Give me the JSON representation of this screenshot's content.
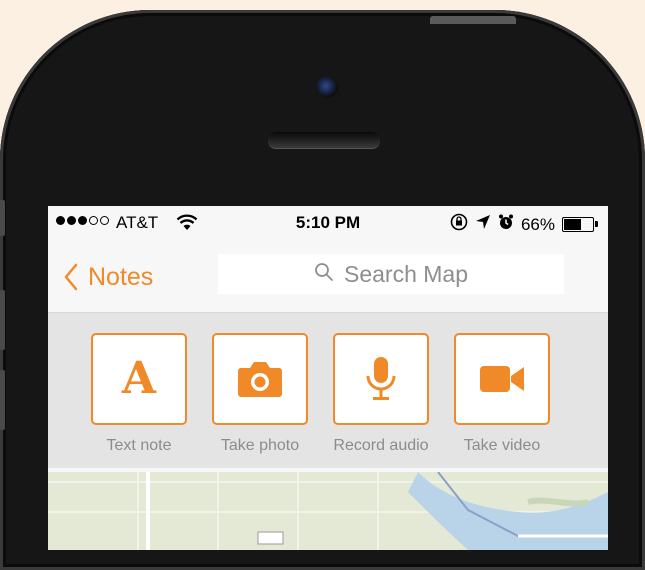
{
  "status_bar": {
    "signal_dots_filled": 3,
    "signal_dots_total": 5,
    "carrier": "AT&T",
    "time": "5:10 PM",
    "battery_percent": "66%",
    "battery_level": 0.66,
    "icons": [
      "wifi-icon",
      "rotation-lock-icon",
      "location-arrow-icon",
      "alarm-icon",
      "battery-icon"
    ]
  },
  "nav": {
    "back_label": "Notes",
    "search_placeholder": "Search Map"
  },
  "actions": [
    {
      "label": "Text note",
      "icon": "letter-a-icon"
    },
    {
      "label": "Take photo",
      "icon": "camera-icon"
    },
    {
      "label": "Record audio",
      "icon": "microphone-icon"
    },
    {
      "label": "Take video",
      "icon": "video-camera-icon"
    }
  ],
  "colors": {
    "accent": "#f08a28",
    "background": "#fbf0e2",
    "phone_body": "#161616"
  }
}
